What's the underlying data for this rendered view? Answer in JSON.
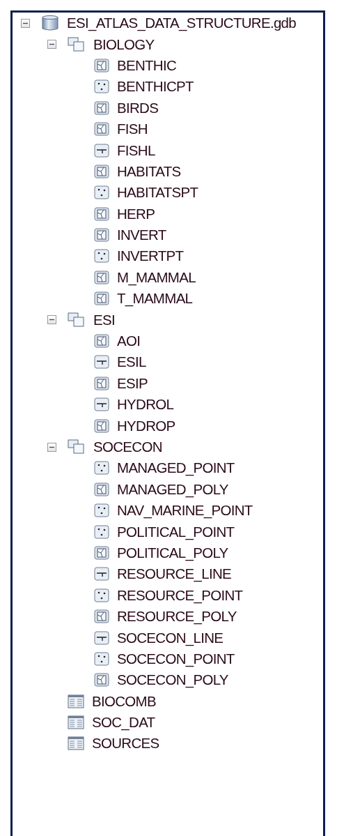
{
  "tree": [
    {
      "label": "ESI_ATLAS_DATA_STRUCTURE.gdb",
      "kind": "database",
      "expanded": true,
      "children": [
        {
          "label": "BIOLOGY",
          "kind": "dataset",
          "expanded": true,
          "children": [
            {
              "label": "BENTHIC",
              "kind": "polygon"
            },
            {
              "label": "BENTHICPT",
              "kind": "point"
            },
            {
              "label": "BIRDS",
              "kind": "polygon"
            },
            {
              "label": "FISH",
              "kind": "polygon"
            },
            {
              "label": "FISHL",
              "kind": "line"
            },
            {
              "label": "HABITATS",
              "kind": "polygon"
            },
            {
              "label": "HABITATSPT",
              "kind": "point"
            },
            {
              "label": "HERP",
              "kind": "polygon"
            },
            {
              "label": "INVERT",
              "kind": "polygon"
            },
            {
              "label": "INVERTPT",
              "kind": "point"
            },
            {
              "label": "M_MAMMAL",
              "kind": "polygon"
            },
            {
              "label": "T_MAMMAL",
              "kind": "polygon"
            }
          ]
        },
        {
          "label": "ESI",
          "kind": "dataset",
          "expanded": true,
          "children": [
            {
              "label": "AOI",
              "kind": "polygon"
            },
            {
              "label": "ESIL",
              "kind": "line"
            },
            {
              "label": "ESIP",
              "kind": "polygon"
            },
            {
              "label": "HYDROL",
              "kind": "line"
            },
            {
              "label": "HYDROP",
              "kind": "polygon"
            }
          ]
        },
        {
          "label": "SOCECON",
          "kind": "dataset",
          "expanded": true,
          "children": [
            {
              "label": "MANAGED_POINT",
              "kind": "point"
            },
            {
              "label": "MANAGED_POLY",
              "kind": "polygon"
            },
            {
              "label": "NAV_MARINE_POINT",
              "kind": "point"
            },
            {
              "label": "POLITICAL_POINT",
              "kind": "point"
            },
            {
              "label": "POLITICAL_POLY",
              "kind": "polygon"
            },
            {
              "label": "RESOURCE_LINE",
              "kind": "line"
            },
            {
              "label": "RESOURCE_POINT",
              "kind": "point"
            },
            {
              "label": "RESOURCE_POLY",
              "kind": "polygon"
            },
            {
              "label": "SOCECON_LINE",
              "kind": "line"
            },
            {
              "label": "SOCECON_POINT",
              "kind": "point"
            },
            {
              "label": "SOCECON_POLY",
              "kind": "polygon"
            }
          ]
        },
        {
          "label": "BIOCOMB",
          "kind": "table"
        },
        {
          "label": "SOC_DAT",
          "kind": "table"
        },
        {
          "label": "SOURCES",
          "kind": "table"
        }
      ]
    }
  ]
}
